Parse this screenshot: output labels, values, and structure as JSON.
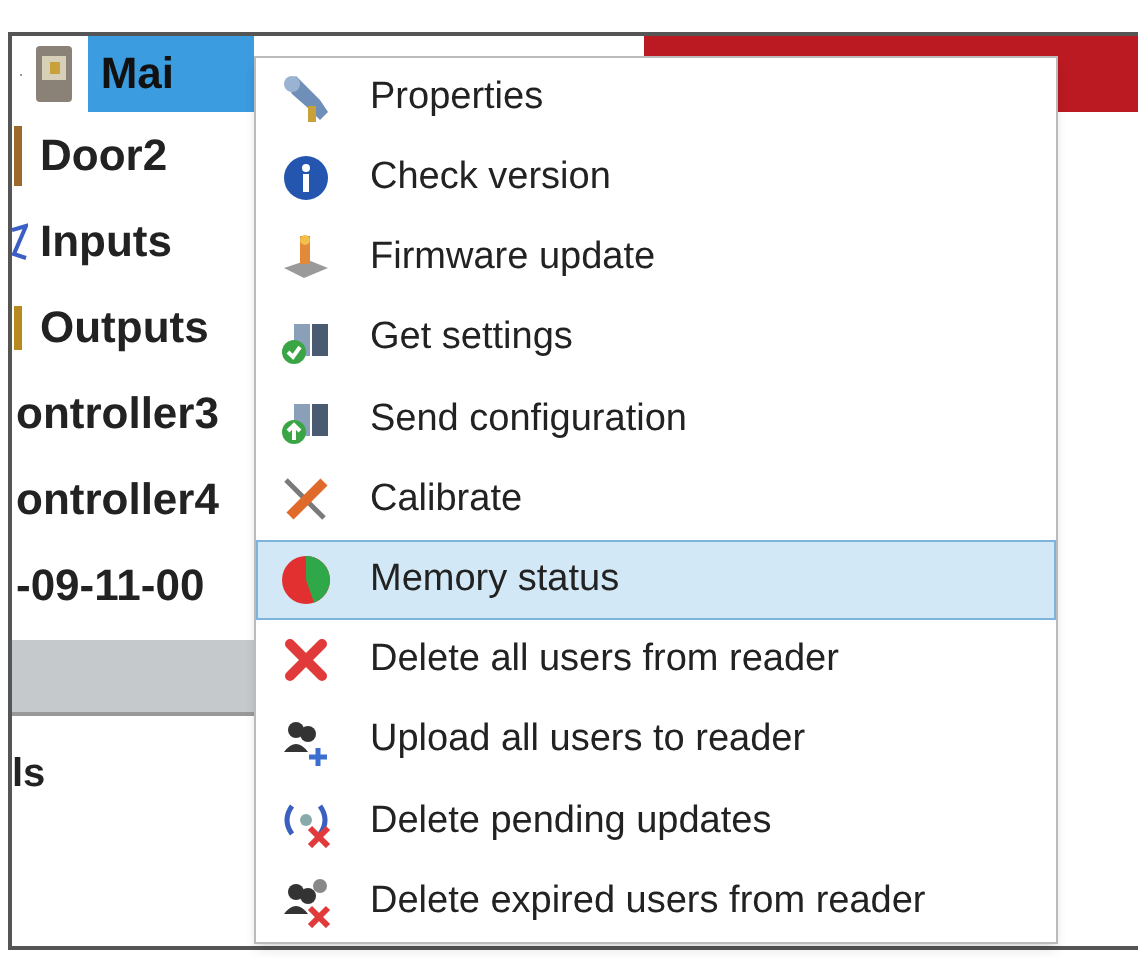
{
  "tree": {
    "items": [
      {
        "label": "Mai",
        "selected": true,
        "kind": "device"
      },
      {
        "label": "Door2",
        "selected": false,
        "kind": "door"
      },
      {
        "label": "Inputs",
        "selected": false,
        "kind": "inputs"
      },
      {
        "label": "Outputs",
        "selected": false,
        "kind": "outputs"
      },
      {
        "label": "ontroller3",
        "selected": false,
        "kind": "text"
      },
      {
        "label": "ontroller4",
        "selected": false,
        "kind": "text"
      },
      {
        "label": "-09-11-00",
        "selected": false,
        "kind": "text"
      }
    ],
    "lower_label": "ls"
  },
  "context_menu": {
    "items": [
      {
        "label": "Properties",
        "selected": false
      },
      {
        "label": "Check version",
        "selected": false
      },
      {
        "label": "Firmware update",
        "selected": false
      },
      {
        "label": "Get settings",
        "selected": false
      },
      {
        "label": "Send configuration",
        "selected": false
      },
      {
        "label": "Calibrate",
        "selected": false
      },
      {
        "label": "Memory status",
        "selected": true
      },
      {
        "label": "Delete all users from reader",
        "selected": false
      },
      {
        "label": "Upload all users to reader",
        "selected": false
      },
      {
        "label": "Delete pending updates",
        "selected": false
      },
      {
        "label": "Delete expired users from reader",
        "selected": false
      }
    ]
  }
}
